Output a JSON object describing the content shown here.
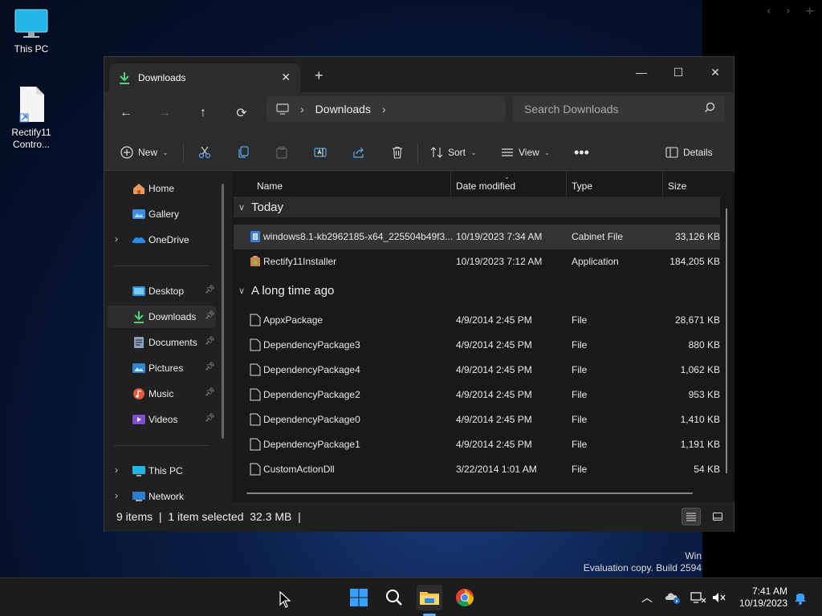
{
  "desktop": {
    "icons": [
      {
        "label": "This PC"
      },
      {
        "label": "Rectify11\nContro..."
      }
    ],
    "watermark_line1": "Win",
    "watermark_line2": "Evaluation copy. Build 2594"
  },
  "window": {
    "tab_title": "Downloads",
    "address": {
      "segments": [
        "Downloads"
      ]
    },
    "search_placeholder": "Search Downloads",
    "toolbar": {
      "new_label": "New",
      "sort_label": "Sort",
      "view_label": "View",
      "details_label": "Details"
    },
    "sidebar": {
      "items": [
        {
          "label": "Home"
        },
        {
          "label": "Gallery"
        },
        {
          "label": "OneDrive"
        },
        {
          "label": "Desktop"
        },
        {
          "label": "Downloads"
        },
        {
          "label": "Documents"
        },
        {
          "label": "Pictures"
        },
        {
          "label": "Music"
        },
        {
          "label": "Videos"
        },
        {
          "label": "This PC"
        },
        {
          "label": "Network"
        }
      ]
    },
    "columns": [
      "Name",
      "Date modified",
      "Type",
      "Size"
    ],
    "groups": [
      {
        "title": "Today",
        "rows": [
          {
            "name": "windows8.1-kb2962185-x64_225504b49f3...",
            "date": "10/19/2023 7:34 AM",
            "type": "Cabinet File",
            "size": "33,126 KB"
          },
          {
            "name": "Rectify11Installer",
            "date": "10/19/2023 7:12 AM",
            "type": "Application",
            "size": "184,205 KB"
          }
        ]
      },
      {
        "title": "A long time ago",
        "rows": [
          {
            "name": "AppxPackage",
            "date": "4/9/2014 2:45 PM",
            "type": "File",
            "size": "28,671 KB"
          },
          {
            "name": "DependencyPackage3",
            "date": "4/9/2014 2:45 PM",
            "type": "File",
            "size": "880 KB"
          },
          {
            "name": "DependencyPackage4",
            "date": "4/9/2014 2:45 PM",
            "type": "File",
            "size": "1,062 KB"
          },
          {
            "name": "DependencyPackage2",
            "date": "4/9/2014 2:45 PM",
            "type": "File",
            "size": "953 KB"
          },
          {
            "name": "DependencyPackage0",
            "date": "4/9/2014 2:45 PM",
            "type": "File",
            "size": "1,410 KB"
          },
          {
            "name": "DependencyPackage1",
            "date": "4/9/2014 2:45 PM",
            "type": "File",
            "size": "1,191 KB"
          },
          {
            "name": "CustomActionDll",
            "date": "3/22/2014 1:01 AM",
            "type": "File",
            "size": "54 KB"
          }
        ]
      }
    ],
    "status": "9 items  |  1 item selected  32.3 MB  |"
  },
  "taskbar": {
    "time": "7:41 AM",
    "date": "10/19/2023",
    "colors": {
      "accent": "#0078d4",
      "win_blue": "#3aa0ff",
      "folder": "#f3c042"
    }
  }
}
